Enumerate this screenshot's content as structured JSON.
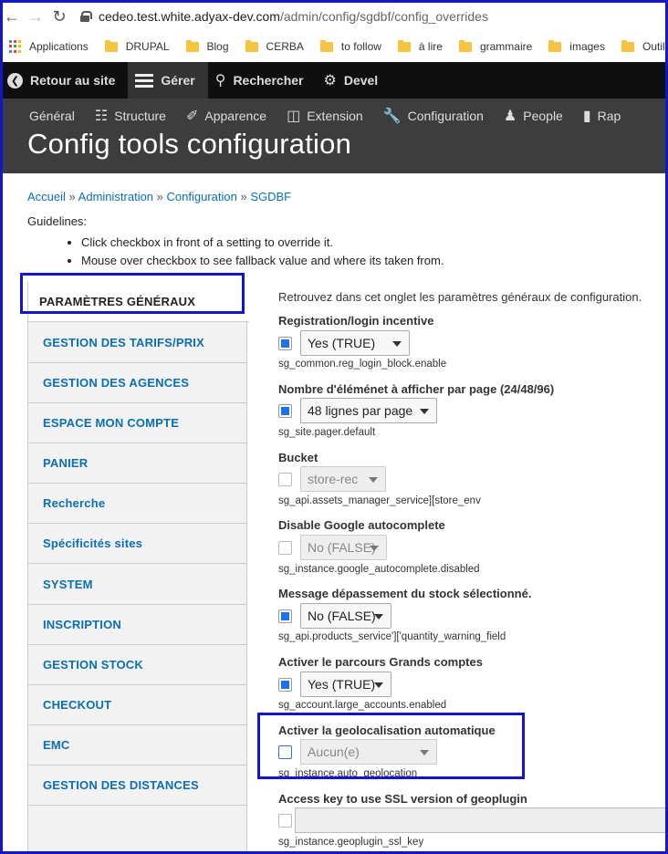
{
  "browser": {
    "url_host": "cedeo.test.white.adyax-dev.com",
    "url_path": "/admin/config/sgdbf/config_overrides",
    "bookmarks": [
      "Applications",
      "DRUPAL",
      "Blog",
      "CERBA",
      "to follow",
      "à lire",
      "grammaire",
      "images",
      "Outils"
    ]
  },
  "toolbar": {
    "items": [
      "Retour au site",
      "Gérer",
      "Rechercher",
      "Devel"
    ]
  },
  "tray": {
    "items": [
      "Général",
      "Structure",
      "Apparence",
      "Extension",
      "Configuration",
      "People",
      "Rap"
    ]
  },
  "page": {
    "title": "Config tools configuration",
    "breadcrumb": [
      "Accueil",
      "Administration",
      "Configuration",
      "SGDBF"
    ],
    "guidelines_title": "Guidelines:",
    "guidelines": [
      "Click checkbox in front of a setting to override it.",
      "Mouse over checkbox to see fallback value and where its taken from."
    ]
  },
  "tabs": [
    "PARAMÈTRES GÉNÉRAUX",
    "GESTION DES TARIFS/PRIX",
    "GESTION DES AGENCES",
    "ESPACE MON COMPTE",
    "PANIER",
    "Recherche",
    "Spécificités sites",
    "SYSTEM",
    "INSCRIPTION",
    "GESTION STOCK",
    "CHECKOUT",
    "EMC",
    "GESTION DES DISTANCES"
  ],
  "form": {
    "intro": "Retrouvez dans cet onglet les paramètres généraux de configuration.",
    "fields": [
      {
        "label": "Registration/login incentive",
        "value": "Yes (TRUE)",
        "key": "sg_common.reg_login_block.enable",
        "checked": true,
        "disabled": false
      },
      {
        "label": "Nombre d'éléménet à afficher par page (24/48/96)",
        "value": "48 lignes par page",
        "key": "sg_site.pager.default",
        "checked": true,
        "disabled": false
      },
      {
        "label": "Bucket",
        "value": "store-rec",
        "key": "sg_api.assets_manager_service][store_env",
        "checked": false,
        "disabled": true
      },
      {
        "label": "Disable Google autocomplete",
        "value": "No (FALSE)",
        "key": "sg_instance.google_autocomplete.disabled",
        "checked": false,
        "disabled": true
      },
      {
        "label": "Message dépassement du stock sélectionné.",
        "value": "No (FALSE)",
        "key": "sg_api.products_service']['quantity_warning_field",
        "checked": true,
        "disabled": false
      },
      {
        "label": "Activer le parcours Grands comptes",
        "value": "Yes (TRUE)",
        "key": "sg_account.large_accounts.enabled",
        "checked": true,
        "disabled": false
      },
      {
        "label": "Activer la geolocalisation automatique",
        "value": "Aucun(e)",
        "key": "sg_instance.auto_geolocation",
        "checked": false,
        "disabled": true
      },
      {
        "label": "Access key to use SSL version of geoplugin",
        "value": "",
        "key": "sg_instance.geoplugin_ssl_key",
        "checked": false,
        "disabled": true
      }
    ]
  },
  "colors": {
    "link": "#0b6fb0",
    "toolbar": "#0f0f0f",
    "tray": "#3d3d3d",
    "highlight": "#1414c8",
    "checkbox": "#1a73e8"
  }
}
